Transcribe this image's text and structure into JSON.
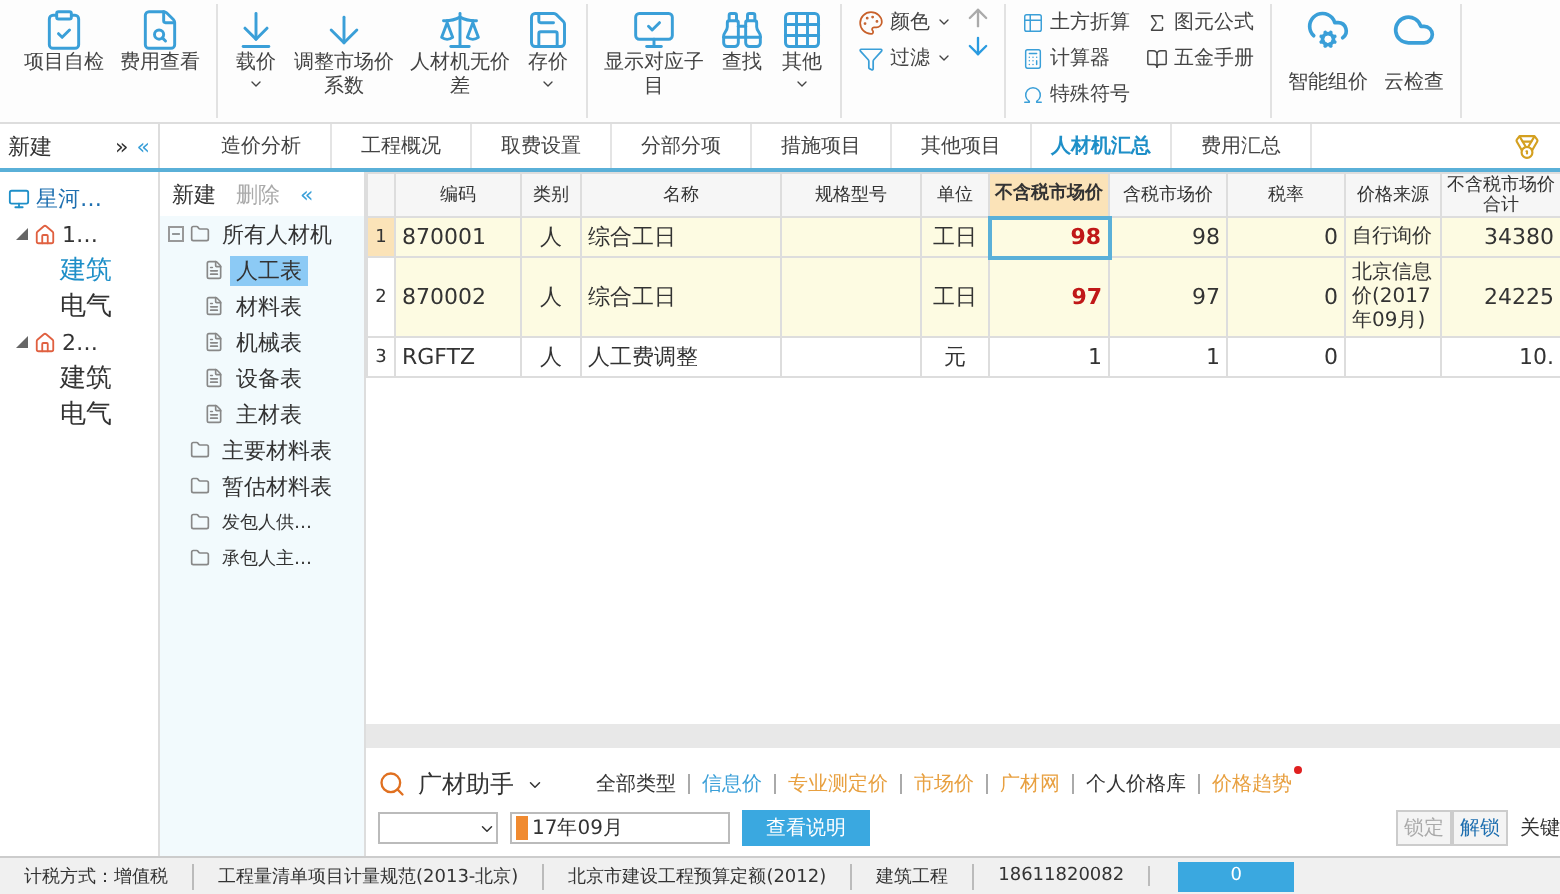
{
  "toolbar": {
    "groups": [
      {
        "buttons": [
          {
            "label": "项目自检",
            "kind": "check"
          },
          {
            "label": "费用查看",
            "kind": "inspect"
          }
        ]
      },
      {
        "buttons": [
          {
            "label": "载价",
            "kind": "load",
            "caret": true
          },
          {
            "label": "调整市场价系数",
            "kind": "adjust",
            "caret": false
          },
          {
            "label": "人材机无价差",
            "kind": "scale",
            "caret": false
          },
          {
            "label": "存价",
            "kind": "save",
            "caret": true
          }
        ]
      },
      {
        "buttons": [
          {
            "label": "显示对应子目",
            "kind": "show",
            "caret": false
          },
          {
            "label": "查找",
            "kind": "find",
            "caret": false
          },
          {
            "label": "其他",
            "kind": "more",
            "caret": true
          }
        ]
      }
    ],
    "small_tools": [
      {
        "label": "颜色",
        "kind": "color"
      },
      {
        "label": "过滤",
        "kind": "filter"
      }
    ],
    "utilities": [
      {
        "label": "土方折算",
        "kind": "earth"
      },
      {
        "label": "计算器",
        "kind": "calculator"
      },
      {
        "label": "特殊符号",
        "kind": "symbol"
      },
      {
        "label": "图元公式",
        "kind": "formula"
      },
      {
        "label": "五金手册",
        "kind": "manual"
      }
    ],
    "cloud_buttons": [
      {
        "label": "智能组价"
      },
      {
        "label": "云检查"
      }
    ]
  },
  "project_panel": {
    "new_label": "新建",
    "expand": "»",
    "collapse": "«",
    "root": "星河…",
    "items": [
      {
        "label": "1…",
        "expanded": true,
        "children": [
          {
            "label": "建筑",
            "selected": true
          },
          {
            "label": "电气",
            "selected": false
          }
        ]
      },
      {
        "label": "2…",
        "expanded": true,
        "children": [
          {
            "label": "建筑",
            "selected": false
          },
          {
            "label": "电气",
            "selected": false
          }
        ]
      }
    ]
  },
  "tabs": [
    {
      "label": "造价分析",
      "selected": false
    },
    {
      "label": "工程概况",
      "selected": false
    },
    {
      "label": "取费设置",
      "selected": false
    },
    {
      "label": "分部分项",
      "selected": false
    },
    {
      "label": "措施项目",
      "selected": false
    },
    {
      "label": "其他项目",
      "selected": false
    },
    {
      "label": "人材机汇总",
      "selected": true
    },
    {
      "label": "费用汇总",
      "selected": false
    }
  ],
  "category_panel": {
    "new_label": "新建",
    "delete_label": "删除",
    "delete_disabled": true,
    "collapse": "«",
    "items": [
      {
        "label": "所有人材机",
        "expanded": true,
        "selected": false,
        "children": [
          {
            "label": "人工表",
            "selected": true
          },
          {
            "label": "材料表",
            "selected": false
          },
          {
            "label": "机械表",
            "selected": false
          },
          {
            "label": "设备表",
            "selected": false
          },
          {
            "label": "主材表",
            "selected": false
          }
        ]
      },
      {
        "label": "主要材料表",
        "selected": false
      },
      {
        "label": "暂估材料表",
        "selected": false
      },
      {
        "label": "发包人供…",
        "selected": false
      },
      {
        "label": "承包人主…",
        "selected": false
      }
    ]
  },
  "table": {
    "columns": [
      "编码",
      "类别",
      "名称",
      "规格型号",
      "单位",
      "不含税市场价",
      "含税市场价",
      "税率",
      "价格来源",
      "不含税市场价合计"
    ],
    "rows": [
      {
        "index": "1",
        "code": "870001",
        "type": "人",
        "name": "综合工日",
        "spec": "",
        "unit": "工日",
        "price": "98",
        "tax_price": "98",
        "tax_rate": "0",
        "source": "自行询价",
        "total": "34380",
        "highlighted": true,
        "selected": true,
        "price_changed": true
      },
      {
        "index": "2",
        "code": "870002",
        "type": "人",
        "name": "综合工日",
        "spec": "",
        "unit": "工日",
        "price": "97",
        "tax_price": "97",
        "tax_rate": "0",
        "source": "北京信息价(2017年09月)",
        "total": "24225",
        "highlighted": true,
        "selected": false,
        "price_changed": true
      },
      {
        "index": "3",
        "code": "RGFTZ",
        "type": "人",
        "name": "人工费调整",
        "spec": "",
        "unit": "元",
        "price": "1",
        "tax_price": "1",
        "tax_rate": "0",
        "source": "",
        "total": "10.",
        "highlighted": false,
        "selected": false,
        "price_changed": false
      }
    ]
  },
  "helper": {
    "title": "广材助手",
    "filters": [
      {
        "label": "全部类型",
        "kind": "plain"
      },
      {
        "label": "信息价",
        "kind": "info"
      },
      {
        "label": "专业测定价",
        "kind": "price"
      },
      {
        "label": "市场价",
        "kind": "price"
      },
      {
        "label": "广材网",
        "kind": "price"
      },
      {
        "label": "个人价格库",
        "kind": "plain"
      },
      {
        "label": "价格趋势",
        "kind": "price",
        "dot": true
      }
    ],
    "period": "17年09月",
    "help_button": "查看说明",
    "lock": {
      "label": "锁定",
      "disabled": true
    },
    "unlock": {
      "label": "解锁",
      "disabled": false
    },
    "keyword": "关键"
  },
  "status_bar": [
    "计税方式：增值税",
    "工程量清单项目计量规范(2013-北京)",
    "北京市建设工程预算定额(2012)",
    "建筑工程",
    "18611820082"
  ],
  "status_counter": "0"
}
